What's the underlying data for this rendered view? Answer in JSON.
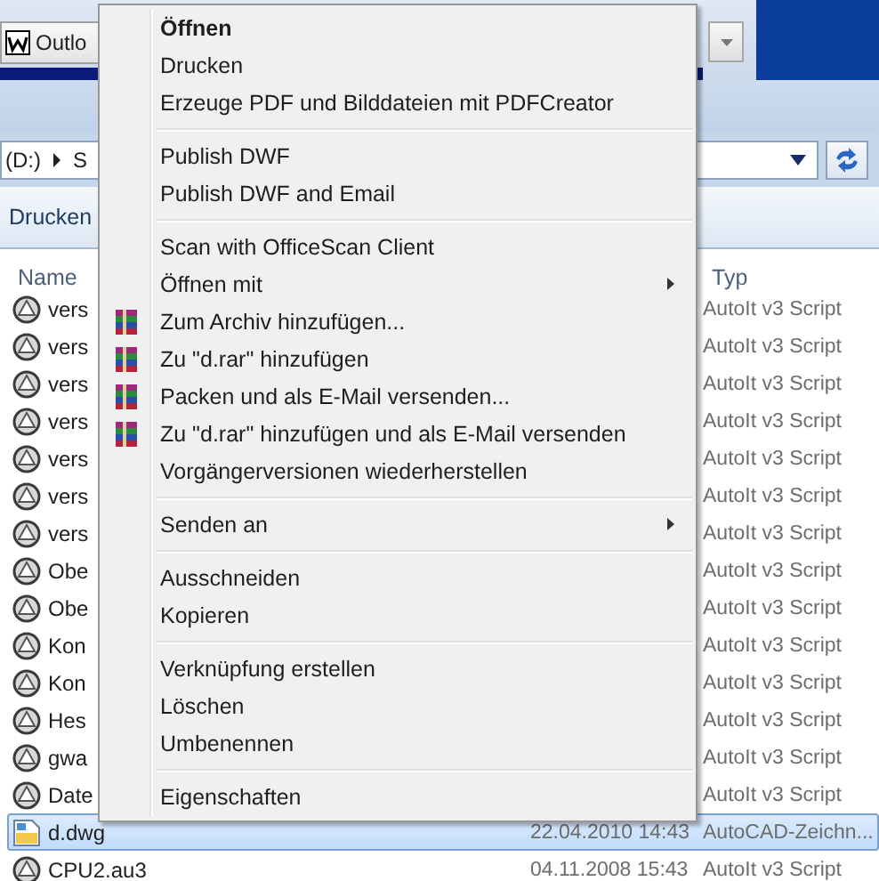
{
  "taskbar": {
    "button": "Outlo"
  },
  "address_bar": {
    "segments": [
      "(D:)",
      "S"
    ]
  },
  "toolbar": {
    "items": [
      "Drucken"
    ]
  },
  "file_list": {
    "columns": [
      "Name",
      "Typ"
    ],
    "rows": [
      {
        "name": "vers",
        "type": "AutoIt v3 Script",
        "kind": "script",
        "selected": false
      },
      {
        "name": "vers",
        "type": "AutoIt v3 Script",
        "kind": "script",
        "selected": false
      },
      {
        "name": "vers",
        "type": "AutoIt v3 Script",
        "kind": "script",
        "selected": false
      },
      {
        "name": "vers",
        "type": "AutoIt v3 Script",
        "kind": "script",
        "selected": false
      },
      {
        "name": "vers",
        "type": "AutoIt v3 Script",
        "kind": "script",
        "selected": false
      },
      {
        "name": "vers",
        "type": "AutoIt v3 Script",
        "kind": "script",
        "selected": false
      },
      {
        "name": "vers",
        "type": "AutoIt v3 Script",
        "kind": "script",
        "selected": false
      },
      {
        "name": "Obe",
        "type": "AutoIt v3 Script",
        "kind": "script",
        "selected": false
      },
      {
        "name": "Obe",
        "type": "AutoIt v3 Script",
        "kind": "script",
        "selected": false
      },
      {
        "name": "Kon",
        "type": "AutoIt v3 Script",
        "kind": "script",
        "selected": false
      },
      {
        "name": "Kon",
        "type": "AutoIt v3 Script",
        "kind": "script",
        "selected": false
      },
      {
        "name": "Hes",
        "type": "AutoIt v3 Script",
        "kind": "script",
        "selected": false
      },
      {
        "name": "gwa",
        "type": "AutoIt v3 Script",
        "kind": "script",
        "selected": false
      },
      {
        "name": "Date",
        "type": "AutoIt v3 Script",
        "kind": "script",
        "selected": false
      },
      {
        "name": "d.dwg",
        "date": "22.04.2010 14:43",
        "type": "AutoCAD-Zeichn...",
        "kind": "drawing",
        "selected": true
      },
      {
        "name": "CPU2.au3",
        "date": "04.11.2008 15:43",
        "type": "AutoIt v3 Script",
        "kind": "script",
        "selected": false
      }
    ]
  },
  "context_menu": {
    "items": [
      {
        "kind": "item",
        "label": "Öffnen",
        "default": true
      },
      {
        "kind": "item",
        "label": "Drucken"
      },
      {
        "kind": "item",
        "label": "Erzeuge PDF und Bilddateien mit PDFCreator"
      },
      {
        "kind": "separator"
      },
      {
        "kind": "item",
        "label": "Publish DWF"
      },
      {
        "kind": "item",
        "label": "Publish DWF and Email"
      },
      {
        "kind": "separator"
      },
      {
        "kind": "item",
        "label": "Scan with OfficeScan Client"
      },
      {
        "kind": "item",
        "label": "Öffnen mit",
        "submenu": true
      },
      {
        "kind": "archive",
        "label": "Zum Archiv hinzufügen..."
      },
      {
        "kind": "archive",
        "label": "Zu \"d.rar\" hinzufügen"
      },
      {
        "kind": "archive",
        "label": "Packen und als E-Mail versenden..."
      },
      {
        "kind": "archive",
        "label": "Zu \"d.rar\" hinzufügen und als E-Mail versenden"
      },
      {
        "kind": "item",
        "label": "Vorgängerversionen wiederherstellen"
      },
      {
        "kind": "separator"
      },
      {
        "kind": "item",
        "label": "Senden an",
        "submenu": true
      },
      {
        "kind": "separator"
      },
      {
        "kind": "item",
        "label": "Ausschneiden"
      },
      {
        "kind": "item",
        "label": "Kopieren"
      },
      {
        "kind": "separator"
      },
      {
        "kind": "item",
        "label": "Verknüpfung erstellen"
      },
      {
        "kind": "item",
        "label": "Löschen"
      },
      {
        "kind": "item",
        "label": "Umbenennen"
      },
      {
        "kind": "separator"
      },
      {
        "kind": "item",
        "label": "Eigenschaften"
      }
    ]
  }
}
